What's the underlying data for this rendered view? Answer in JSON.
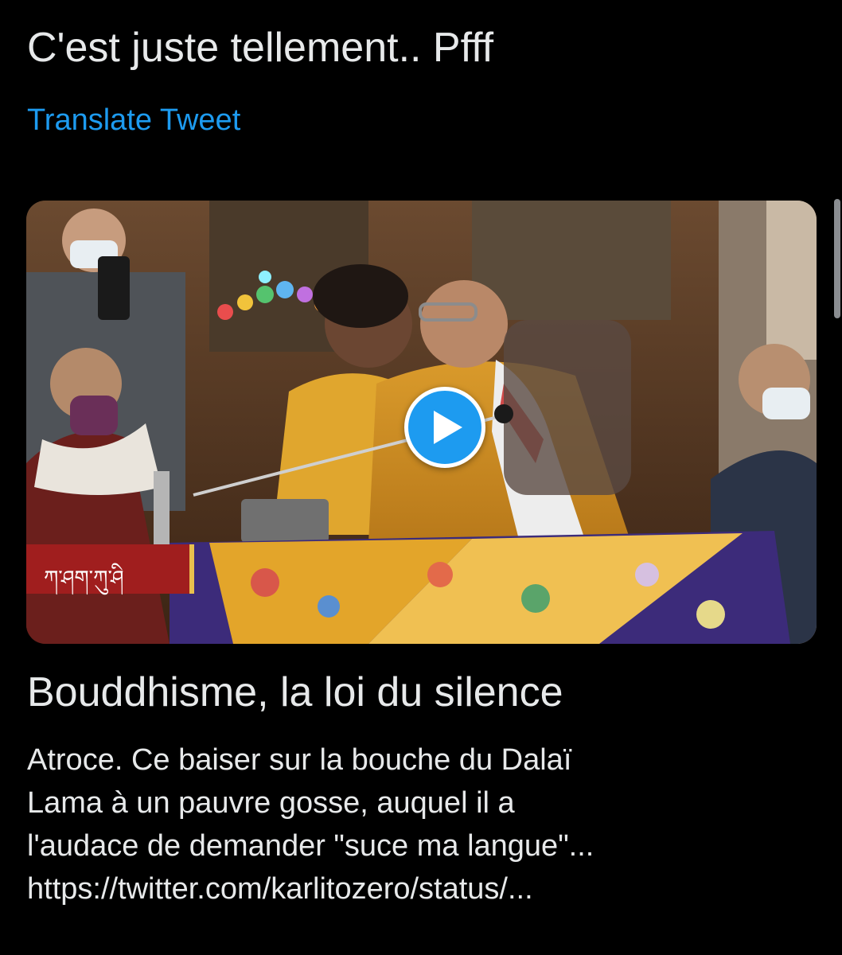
{
  "tweet": {
    "text": "C'est juste tellement.. Pfff",
    "translate_label": "Translate Tweet"
  },
  "media": {
    "overlay_caption": "ཀ་ཤག་ཀུ་ཤི",
    "play_icon": "play-icon"
  },
  "card": {
    "title": "Bouddhisme, la loi du silence",
    "description_lines": [
      "Atroce. Ce baiser sur la bouche du Dalaï",
      "Lama à un pauvre gosse, auquel il a",
      "l'audace de demander \"suce ma langue\"...",
      "https://twitter.com/karlitozero/status/..."
    ]
  },
  "colors": {
    "background": "#000000",
    "text": "#e7e9ea",
    "link": "#1d9bf0",
    "play_button": "#1d9bf0"
  }
}
